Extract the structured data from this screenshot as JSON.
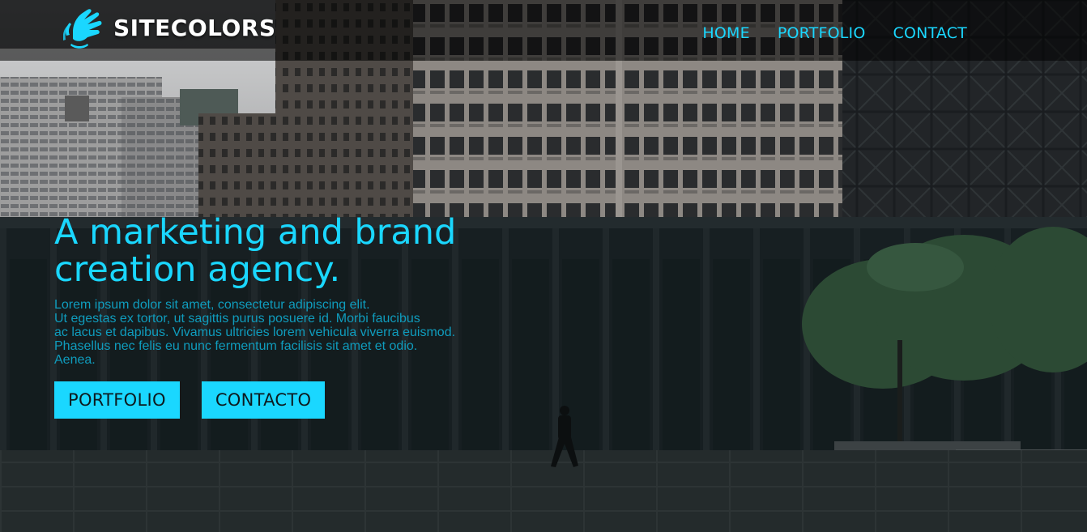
{
  "brand": {
    "name": "SITECOLORS",
    "logo_icon": "hand-wave-icon"
  },
  "nav": {
    "items": [
      {
        "label": "HOME"
      },
      {
        "label": "PORTFOLIO"
      },
      {
        "label": "CONTACT"
      }
    ]
  },
  "hero": {
    "headline_line1": "A marketing and brand",
    "headline_line2": "creation agency.",
    "body_lines": [
      "Lorem ipsum dolor sit amet, consectetur adipiscing elit.",
      "Ut egestas ex tortor, ut sagittis purus posuere id. Morbi faucibus",
      "ac lacus et dapibus. Vivamus ultricies lorem vehicula viverra euismod.",
      "Phasellus nec felis eu nunc fermentum facilisis sit amet et odio.",
      "Aenea."
    ],
    "buttons": {
      "portfolio": "PORTFOLIO",
      "contact": "CONTACTO"
    }
  },
  "colors": {
    "accent": "#1ad7ff",
    "nav_background": "#000000",
    "button_text": "#0d1a1f"
  }
}
